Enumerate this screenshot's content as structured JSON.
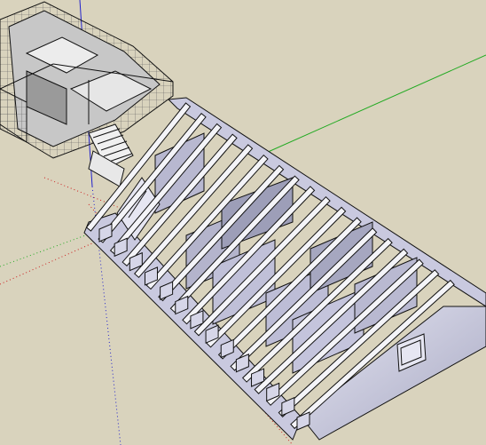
{
  "app": {
    "kind": "3d-model-viewport"
  },
  "scene": {
    "background_color": "#d9d3bd",
    "axis_colors": {
      "green": "#22aa22",
      "red": "#cc2222",
      "blue": "#2222cc"
    },
    "rafter_count": 18,
    "wall_color": "#c9c9df",
    "wall_shadow_color": "#8d8ea8",
    "line_color": "#111111"
  }
}
